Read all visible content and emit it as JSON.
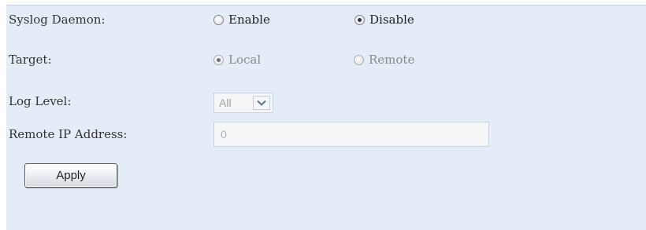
{
  "syslog_daemon": {
    "label": "Syslog Daemon:",
    "options": [
      {
        "label": "Enable",
        "checked": false
      },
      {
        "label": "Disable",
        "checked": true
      }
    ]
  },
  "target": {
    "label": "Target:",
    "disabled": true,
    "options": [
      {
        "label": "Local",
        "checked": true
      },
      {
        "label": "Remote",
        "checked": false
      }
    ]
  },
  "log_level": {
    "label": "Log Level:",
    "value": "All",
    "disabled": true
  },
  "remote_ip": {
    "label": "Remote IP Address:",
    "value": "0",
    "disabled": true
  },
  "apply_button": {
    "label": "Apply"
  },
  "icons": {
    "dropdown": "chevron-down-icon"
  },
  "colors": {
    "panel_background": "#e4ecf7",
    "disabled_text": "#8a8a8a"
  }
}
